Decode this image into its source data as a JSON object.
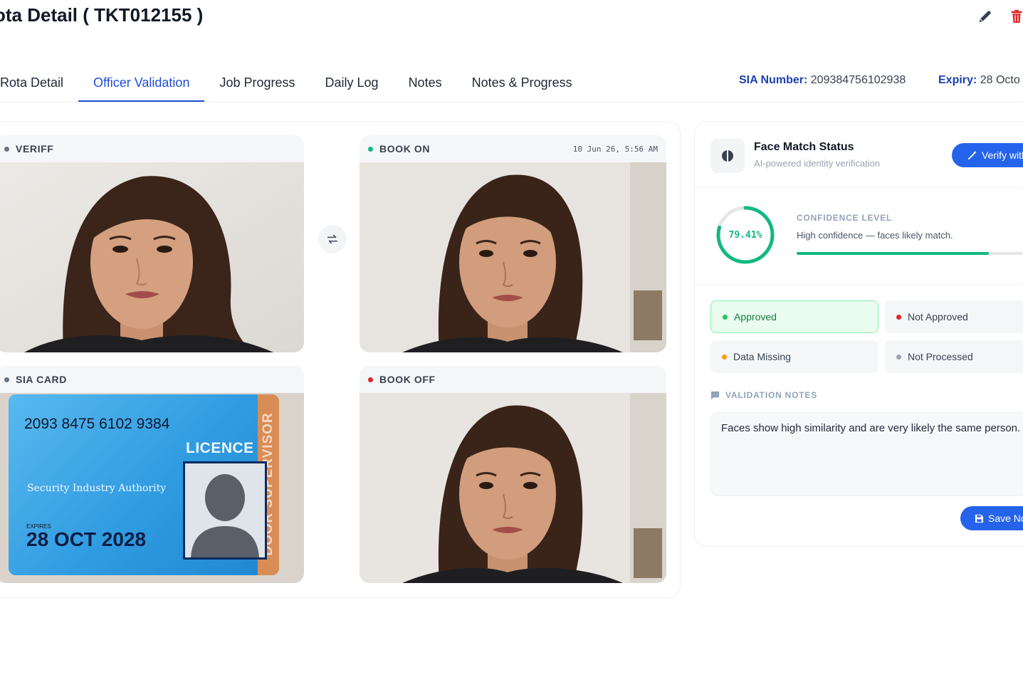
{
  "header": {
    "title": "ota Detail ( TKT012155 )",
    "edit_icon": "pencil-icon",
    "delete_icon": "trash-icon"
  },
  "tabs": [
    {
      "label": "Rota Detail",
      "active": false
    },
    {
      "label": "Officer Validation",
      "active": true
    },
    {
      "label": "Job Progress",
      "active": false
    },
    {
      "label": "Daily Log",
      "active": false
    },
    {
      "label": "Notes",
      "active": false
    },
    {
      "label": "Notes & Progress",
      "active": false
    }
  ],
  "meta": {
    "sia_label": "SIA Number:",
    "sia_value": "209384756102938",
    "expiry_label": "Expiry:",
    "expiry_value": "28 Octo"
  },
  "photos": {
    "veriff": {
      "label": "VERIFF",
      "dot_color": "#6b7280"
    },
    "book_on": {
      "label": "BOOK ON",
      "timestamp": "10 Jun 26, 5:56 AM",
      "dot_color": "#10b981"
    },
    "sia_card": {
      "label": "SIA CARD",
      "dot_color": "#6b7280"
    },
    "book_off": {
      "label": "BOOK OFF",
      "dot_color": "#dc2626"
    },
    "swap_icon": "swap-arrows-icon"
  },
  "sia_card_image": {
    "number": "2093 8475 6102 9384",
    "licence": "LICENCE",
    "authority": "Security Industry Authority",
    "expires_label": "EXPIRES",
    "expires_value": "28 OCT 2028",
    "role": "DOOR SUPERVISOR"
  },
  "face_match": {
    "title": "Face Match Status",
    "subtitle": "AI-powered identity verification",
    "verify_button": "Verify with",
    "confidence_value": "79.41%",
    "confidence_fraction": 0.7941,
    "confidence_label": "CONFIDENCE LEVEL",
    "confidence_text": "High confidence — faces likely match.",
    "accent_color": "#10b981"
  },
  "statuses": [
    {
      "label": "Approved",
      "dot_color": "#22c55e",
      "active": true
    },
    {
      "label": "Not Approved",
      "dot_color": "#dc2626",
      "active": false
    },
    {
      "label": "Data Missing",
      "dot_color": "#f59e0b",
      "active": false
    },
    {
      "label": "Not Processed",
      "dot_color": "#9ca3af",
      "active": false
    }
  ],
  "validation_notes": {
    "label": "VALIDATION NOTES",
    "text": "Faces show high similarity and are very likely the same person.",
    "save_button": "Save No"
  }
}
